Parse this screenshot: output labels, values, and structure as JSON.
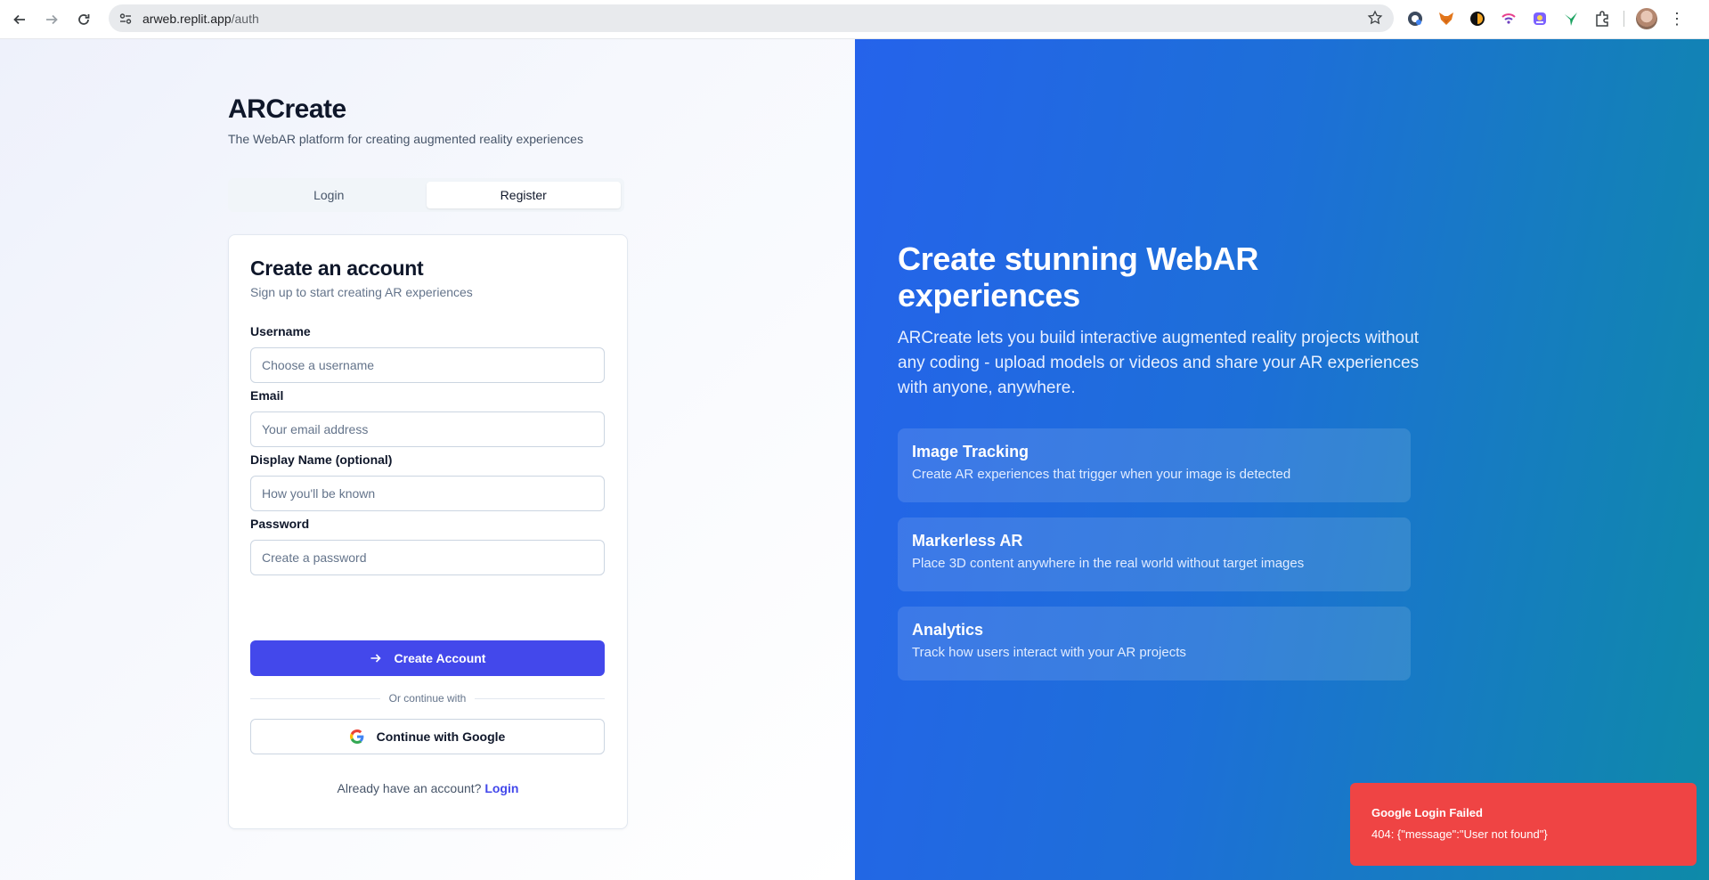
{
  "browser": {
    "url_host": "arweb.replit.app",
    "url_path": "/auth"
  },
  "brand": {
    "title": "ARCreate",
    "subtitle": "The WebAR platform for creating augmented reality experiences"
  },
  "tabs": [
    {
      "label": "Login",
      "active": false
    },
    {
      "label": "Register",
      "active": true
    }
  ],
  "form": {
    "title": "Create an account",
    "subtitle": "Sign up to start creating AR experiences",
    "fields": [
      {
        "label": "Username",
        "placeholder": "Choose a username",
        "value": ""
      },
      {
        "label": "Email",
        "placeholder": "Your email address",
        "value": ""
      },
      {
        "label": "Display Name (optional)",
        "placeholder": "How you'll be known",
        "value": ""
      },
      {
        "label": "Password",
        "placeholder": "Create a password",
        "value": ""
      }
    ],
    "submit_label": "Create Account",
    "divider_text": "Or continue with",
    "google_label": "Continue with Google",
    "footer_text": "Already have an account?",
    "footer_link": "Login"
  },
  "hero": {
    "title": "Create stunning WebAR experiences",
    "body": "ARCreate lets you build interactive augmented reality projects without any coding - upload models or videos and share your AR experiences with anyone, anywhere.",
    "features": [
      {
        "title": "Image Tracking",
        "desc": "Create AR experiences that trigger when your image is detected"
      },
      {
        "title": "Markerless AR",
        "desc": "Place 3D content anywhere in the real world without target images"
      },
      {
        "title": "Analytics",
        "desc": "Track how users interact with your AR projects"
      }
    ]
  },
  "toast": {
    "title": "Google Login Failed",
    "message": "404: {\"message\":\"User not found\"}"
  },
  "colors": {
    "primary": "#4348eb",
    "hero_start": "#2563eb",
    "hero_end": "#0e8aa8",
    "toast_bg": "#ef4444"
  }
}
